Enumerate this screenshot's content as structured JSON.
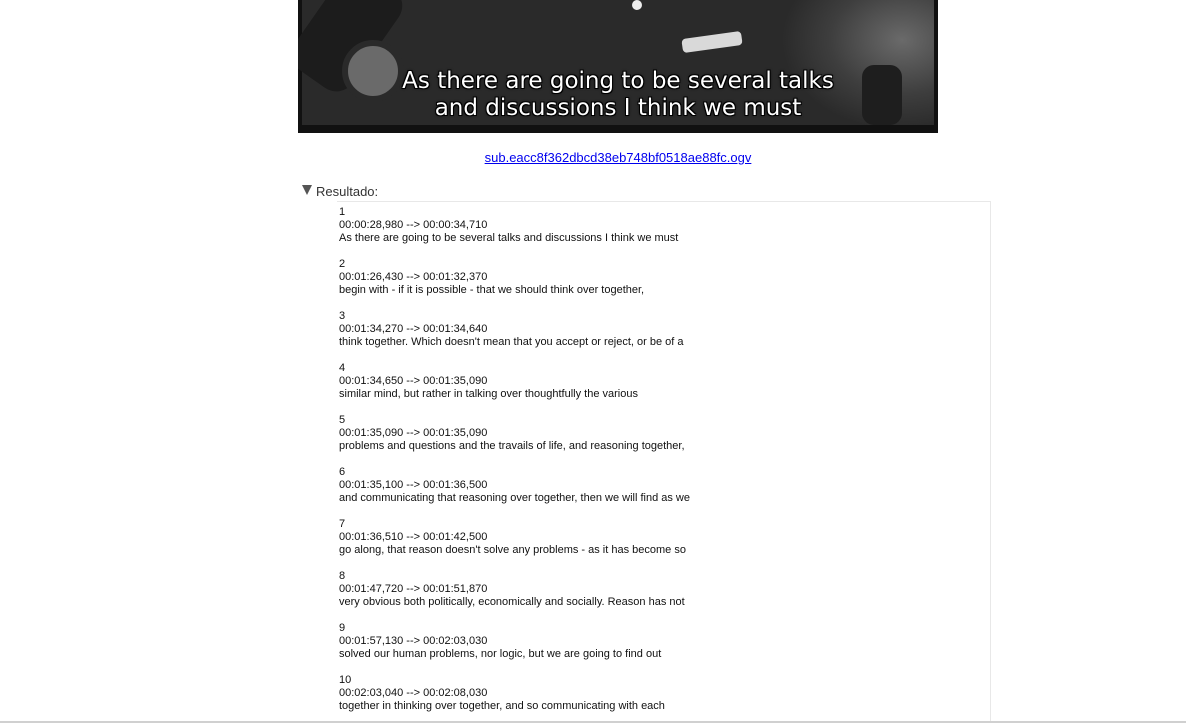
{
  "video": {
    "caption_line1": "As there are going to be several talks",
    "caption_line2": "and discussions I think we must"
  },
  "file_link": "sub.eacc8f362dbcd38eb748bf0518ae88fc.ogv",
  "details": {
    "summary": "Resultado:",
    "cues": [
      {
        "index": "1",
        "time": "00:00:28,980 --> 00:00:34,710",
        "text": "As there are going to be several talks and discussions I think we must"
      },
      {
        "index": "2",
        "time": "00:01:26,430 --> 00:01:32,370",
        "text": "begin with - if it is possible - that we should think over together,"
      },
      {
        "index": "3",
        "time": "00:01:34,270 --> 00:01:34,640",
        "text": "think together. Which doesn't mean that you accept or reject, or be of a"
      },
      {
        "index": "4",
        "time": "00:01:34,650 --> 00:01:35,090",
        "text": "similar mind, but rather in talking over thoughtfully the various"
      },
      {
        "index": "5",
        "time": "00:01:35,090 --> 00:01:35,090",
        "text": "problems and questions and the travails of life, and reasoning together,"
      },
      {
        "index": "6",
        "time": "00:01:35,100 --> 00:01:36,500",
        "text": "and communicating that reasoning over together, then we will find as we"
      },
      {
        "index": "7",
        "time": "00:01:36,510 --> 00:01:42,500",
        "text": "go along, that reason doesn't solve any problems - as it has become so"
      },
      {
        "index": "8",
        "time": "00:01:47,720 --> 00:01:51,870",
        "text": "very obvious both politically, economically and socially. Reason has not"
      },
      {
        "index": "9",
        "time": "00:01:57,130 --> 00:02:03,030",
        "text": "solved our human problems, nor logic, but we are going to find out"
      },
      {
        "index": "10",
        "time": "00:02:03,040 --> 00:02:08,030",
        "text": "together in thinking over together, and so communicating with each"
      }
    ]
  }
}
